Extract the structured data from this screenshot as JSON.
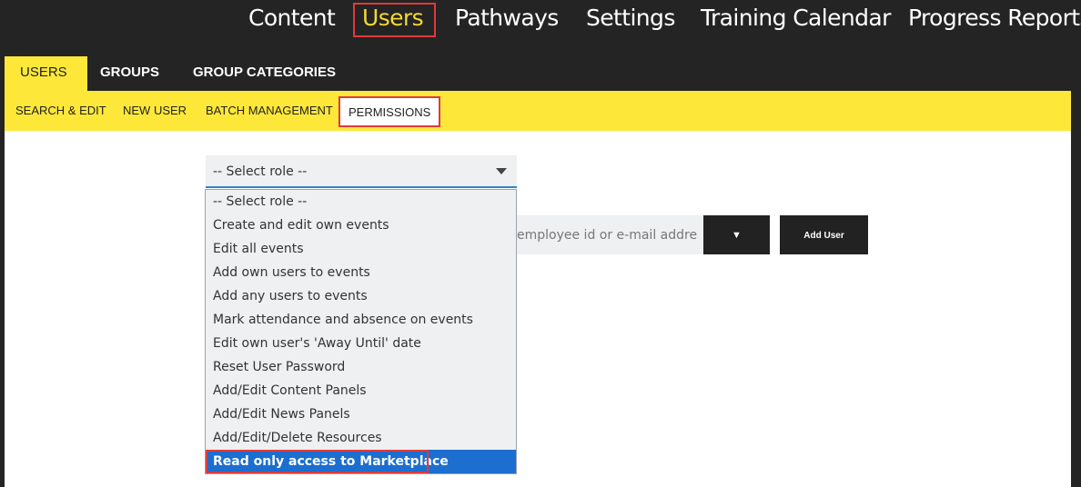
{
  "topnav": {
    "items": [
      "Content",
      "Users",
      "Pathways",
      "Settings",
      "Training Calendar",
      "Progress Reports"
    ],
    "active": "Users"
  },
  "tabs": {
    "items": [
      "USERS",
      "GROUPS",
      "GROUP CATEGORIES"
    ],
    "active": "USERS"
  },
  "subnav": {
    "items": [
      "SEARCH & EDIT",
      "NEW USER",
      "BATCH MANAGEMENT",
      "PERMISSIONS"
    ],
    "active": "PERMISSIONS"
  },
  "role_select": {
    "value": "-- Select role --",
    "options": [
      "-- Select role --",
      "Create and edit own events",
      "Edit all events",
      "Add own users to events",
      "Add any users to events",
      "Mark attendance and absence on events",
      "Edit own user's 'Away Until' date",
      "Reset User Password",
      "Add/Edit Content Panels",
      "Add/Edit News Panels",
      "Add/Edit/Delete Resources",
      "Read only access to Marketplace"
    ],
    "highlighted": "Read only access to Marketplace"
  },
  "add_user": {
    "placeholder": "employee id or e-mail address",
    "dropdown_glyph": "▼",
    "button_label": "Add User"
  },
  "colors": {
    "background": "#242424",
    "accent_yellow": "#fde83a",
    "active_nav_text": "#f5d830",
    "highlight_red": "#e03a3a",
    "selection_blue": "#1c6ecf"
  }
}
